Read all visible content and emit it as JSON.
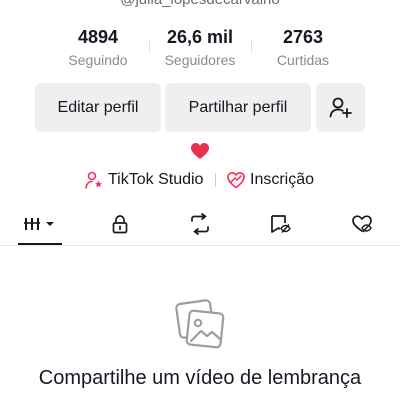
{
  "profile": {
    "username": "@julia_lopesdecarvalho"
  },
  "stats": {
    "following": {
      "value": "4894",
      "label": "Seguindo"
    },
    "followers": {
      "value": "26,6 mil",
      "label": "Seguidores"
    },
    "likes": {
      "value": "2763",
      "label": "Curtidas"
    }
  },
  "actions": {
    "edit_label": "Editar perfil",
    "share_label": "Partilhar perfil",
    "add_friend_icon": "person-add-icon"
  },
  "bio": {
    "emoji": "heart"
  },
  "links": {
    "studio_label": "TikTok Studio",
    "subscription_label": "Inscrição"
  },
  "tabs": {
    "items": [
      "videos",
      "private",
      "reposts",
      "favorites",
      "liked"
    ],
    "active": "videos"
  },
  "empty_state": {
    "icon": "photo-album-icon",
    "message": "Compartilhe um vídeo de lembrança"
  },
  "colors": {
    "accent": "#fe2c55",
    "button_bg": "#efefef",
    "text_primary": "#161823",
    "text_secondary": "#8a8b91"
  }
}
